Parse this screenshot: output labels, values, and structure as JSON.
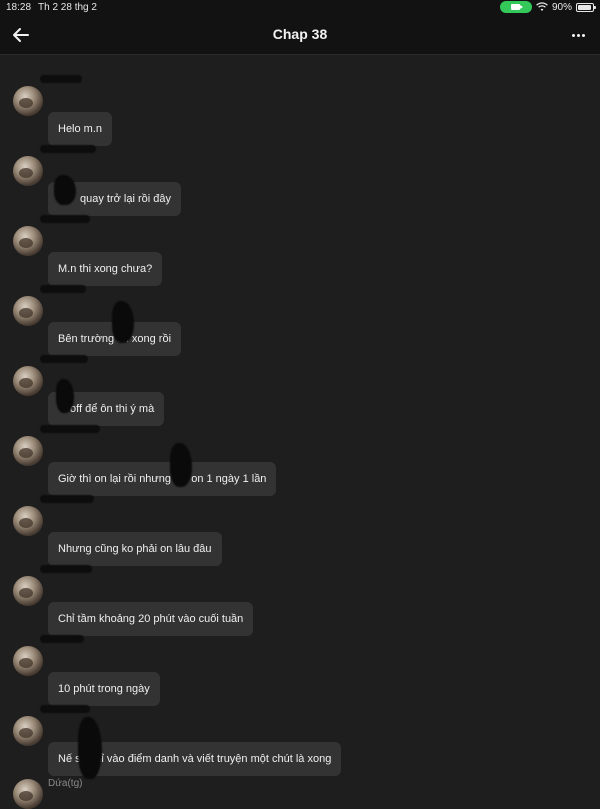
{
  "status_bar": {
    "time": "18:28",
    "date": "Th 2 28 thg 2",
    "battery": "90%",
    "accent_color": "#34c759"
  },
  "header": {
    "back_icon": "arrow-left-icon",
    "title": "Chap 38",
    "more_icon": "ellipsis-icon"
  },
  "messages": [
    {
      "text": "Helo m.n"
    },
    {
      "text": "quay trở lại rồi đây"
    },
    {
      "text": "M.n thi xong chưa?"
    },
    {
      "text": "Bên trường      thi xong rồi"
    },
    {
      "text": "off để ôn thi ý mà"
    },
    {
      "text": "Giờ thì on lại rồi nhưng        chỉ on 1 ngày 1 lần"
    },
    {
      "text": "Nhưng cũng ko phải on lâu đâu"
    },
    {
      "text": "Chỉ tầm khoảng 20 phút vào cuối tuần"
    },
    {
      "text": "10 phút trong ngày"
    },
    {
      "text": "Nế        sẽ chỉ vào điểm danh và viết truyện một chút là xong"
    }
  ],
  "last_author": "Dứa(tg)"
}
